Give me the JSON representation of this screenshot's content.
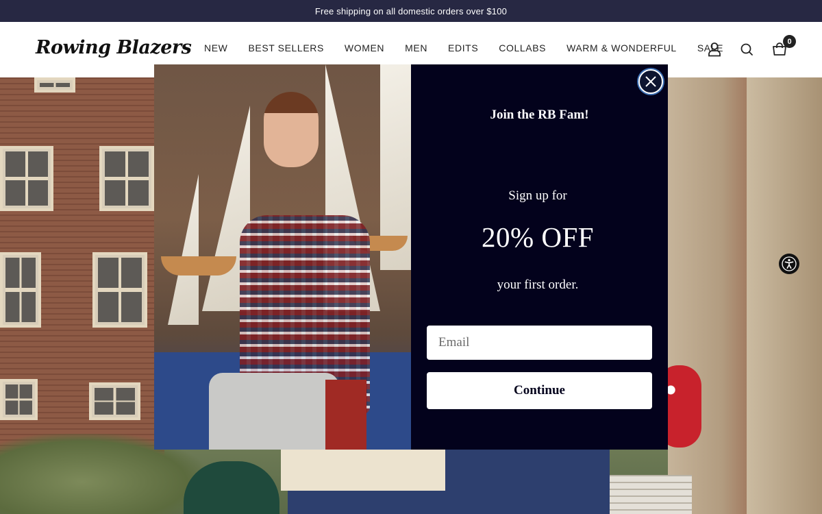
{
  "announcement": {
    "text": "Free shipping on all domestic orders over $100"
  },
  "header": {
    "logo": "Rowing Blazers",
    "nav": [
      "NEW",
      "BEST SELLERS",
      "WOMEN",
      "MEN",
      "EDITS",
      "COLLABS",
      "WARM & WONDERFUL",
      "SALE"
    ],
    "icons": {
      "account": "user-icon",
      "search": "search-icon",
      "cart": "bag-icon"
    },
    "cart_count": "0"
  },
  "modal": {
    "title": "Join the RB Fam!",
    "signup_text": "Sign up for",
    "discount": "20% OFF",
    "first_order_text": "your first order.",
    "email_placeholder": "Email",
    "continue_label": "Continue",
    "close_icon": "close-icon"
  },
  "accessibility": {
    "icon": "accessibility-icon"
  },
  "colors": {
    "announce_bg": "#272843",
    "modal_panel_bg": "#03021c",
    "accent_ring": "#3d6fb3"
  }
}
